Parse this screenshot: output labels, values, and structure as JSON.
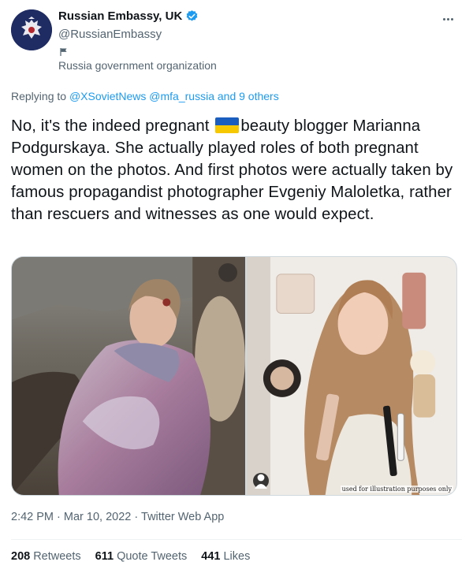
{
  "author": {
    "display_name": "Russian Embassy, UK",
    "handle": "@RussianEmbassy",
    "label": "Russia government organization",
    "avatar_icon": "coat-of-arms-icon",
    "verified_icon": "verified-badge-icon"
  },
  "reply": {
    "prefix": "Replying to",
    "mentions": [
      "@XSovietNews",
      "@mfa_russia"
    ],
    "others": "and 9 others"
  },
  "tweet": {
    "text_before_flag": "No, it's the indeed pregnant ",
    "flag_icon": "ukraine-flag-emoji",
    "text_after_flag": "beauty blogger Marianna Podgurskaya. She actually played roles of both pregnant women on the photos. And first photos were actually taken by famous propagandist photographer Evgeniy Maloletka, rather than rescuers and witnesses as one would expect."
  },
  "media": {
    "right_caption": "used for illustration purposes only"
  },
  "meta": {
    "time": "2:42 PM",
    "date": "Mar 10, 2022",
    "source": "Twitter Web App",
    "separator": "·"
  },
  "stats": [
    {
      "count": "208",
      "label": "Retweets"
    },
    {
      "count": "611",
      "label": "Quote Tweets"
    },
    {
      "count": "441",
      "label": "Likes"
    }
  ],
  "colors": {
    "link": "#1d9bf0",
    "secondary_text": "#536471",
    "primary_text": "#0f1419",
    "verified": "#1d9bf0"
  }
}
